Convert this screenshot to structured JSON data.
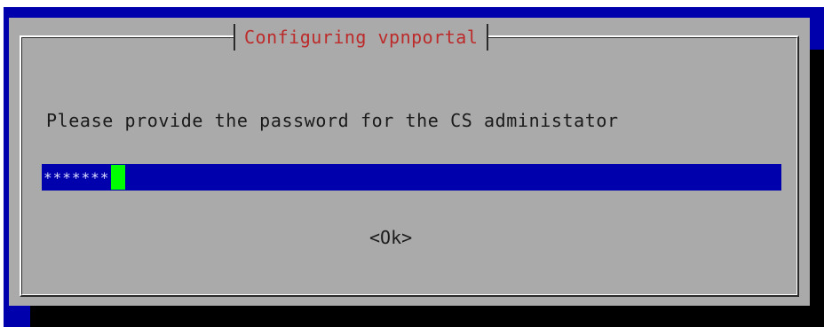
{
  "dialog": {
    "title": "Configuring vpnportal",
    "prompt": "Please provide the password for the CS administator",
    "password_value": "*******",
    "ok_label": "<Ok>"
  },
  "colors": {
    "background_blue": "#0000ad",
    "dialog_gray": "#aaaaaa",
    "title_red": "#bd2a2a",
    "cursor_green": "#00ff00"
  }
}
